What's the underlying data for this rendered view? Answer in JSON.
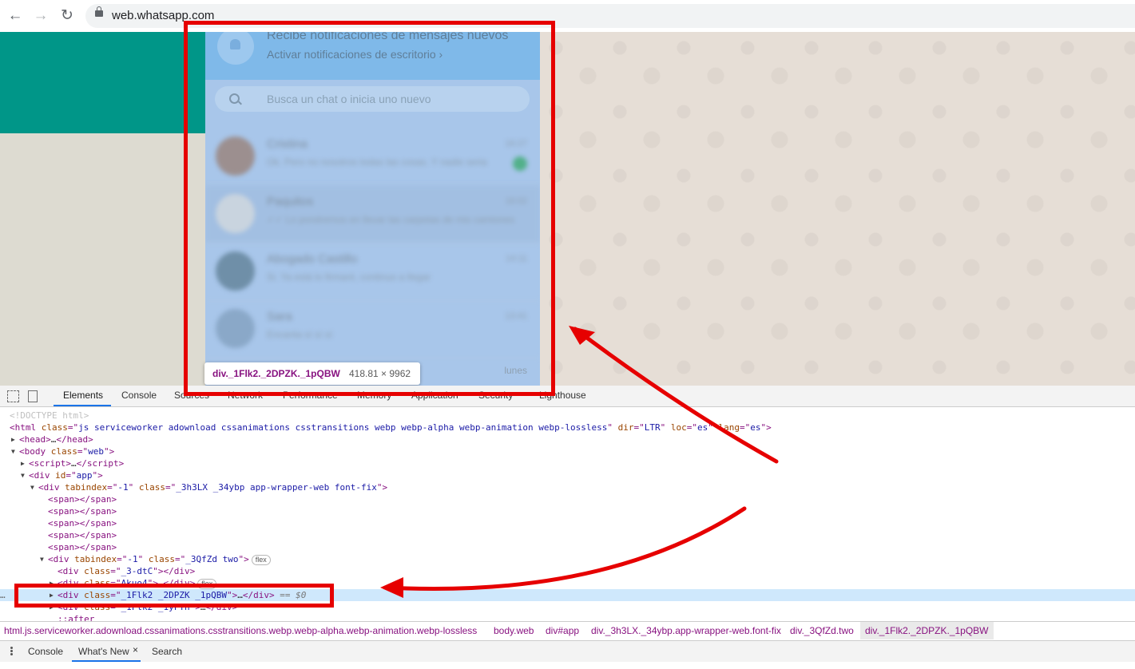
{
  "browser": {
    "url": "web.whatsapp.com",
    "back_icon": "←",
    "forward_icon": "→",
    "reload_icon": "↻"
  },
  "whatsapp": {
    "notification_title": "Recibe notificaciones de mensajes nuevos",
    "notification_subtitle": "Activar notificaciones de escritorio ›",
    "search_placeholder": "Busca un chat o inicia uno nuevo",
    "chats": [
      {
        "name": "Cristina",
        "preview": "Ok. Pero no nosotros todas las cosas. Y nadie seria",
        "time": "16:27",
        "avatar_color": "#9c8f8f",
        "unread": true
      },
      {
        "name": "Paquitos",
        "preview": "✓✓ Lo pondremos en llevar las carpetas de mis camiones",
        "time": "16:02",
        "avatar_color": "#c9d4df",
        "unread": false
      },
      {
        "name": "Abogado Castillo",
        "preview": "Si. Ya está lo firmaré, continuo a llegar",
        "time": "14:11",
        "avatar_color": "#6f8fa8",
        "unread": false
      },
      {
        "name": "Sara",
        "preview": "Encanta sí sí sí",
        "time": "13:41",
        "avatar_color": "#8aa8c8",
        "unread": false
      }
    ],
    "last_row_time": "lunes"
  },
  "tooltip": {
    "element": "div._1Flk2._2DPZK._1pQBW",
    "size": "418.81 × 9962"
  },
  "devtools": {
    "tabs": [
      "Elements",
      "Console",
      "Sources",
      "Network",
      "Performance",
      "Memory",
      "Application",
      "Security",
      "Lighthouse"
    ],
    "active_tab": "Elements",
    "dom": {
      "doctype": "<!DOCTYPE html>",
      "html_class": "js serviceworker adownload cssanimations csstransitions webp webp-alpha webp-animation webp-lossless",
      "html_dir": "LTR",
      "html_loc": "es",
      "html_lang": "es",
      "body_class": "web",
      "app_id": "app",
      "wrapper_tabindex": "-1",
      "wrapper_class": "_3h3LX _34ybp app-wrapper-web font-fix",
      "two_tabindex": "-1",
      "two_class": "_3QfZd two",
      "child1_class": "_3-dtC",
      "child2_class": "Akuo4",
      "selected_class": "_1Flk2 _2DPZK _1pQBW",
      "next_class": "_1Flk2 _1yFTh",
      "after": "::after",
      "flex_badge": "flex",
      "eq_marker": "== $0",
      "ellipsis": "…"
    },
    "breadcrumbs": [
      "html.js.serviceworker.adownload.cssanimations.csstransitions.webp.webp-alpha.webp-animation.webp-lossless",
      "body.web",
      "div#app",
      "div._3h3LX._34ybp.app-wrapper-web.font-fix",
      "div._3QfZd.two",
      "div._1Flk2._2DPZK._1pQBW"
    ],
    "drawer_tabs": [
      "Console",
      "What's New",
      "Search"
    ],
    "drawer_active": "What's New",
    "drawer_close": "×",
    "dots_label": "…"
  },
  "annotation_colors": {
    "highlight": "#e60000"
  }
}
